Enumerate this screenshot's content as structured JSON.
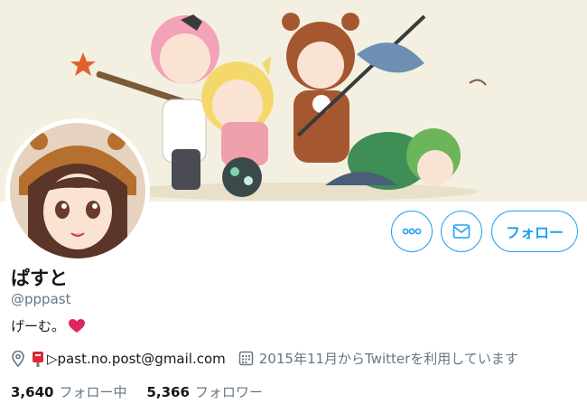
{
  "profile": {
    "name": "ぱすと",
    "handle": "@pppast",
    "bio": "げーむ。",
    "bio_emoji": "heart-icon",
    "link_text": "▷past.no.post@gmail.com",
    "joined": "2015年11月からTwitterを利用しています"
  },
  "actions": {
    "more_icon": "more-dots-icon",
    "message_icon": "envelope-icon",
    "follow_label": "フォロー"
  },
  "stats": {
    "following_count": "3,640",
    "following_label": "フォロー中",
    "followers_count": "5,366",
    "followers_label": "フォロワー"
  },
  "colors": {
    "accent": "#1da1f2",
    "banner_bg": "#f4f0e1",
    "heart": "#e0245e"
  }
}
